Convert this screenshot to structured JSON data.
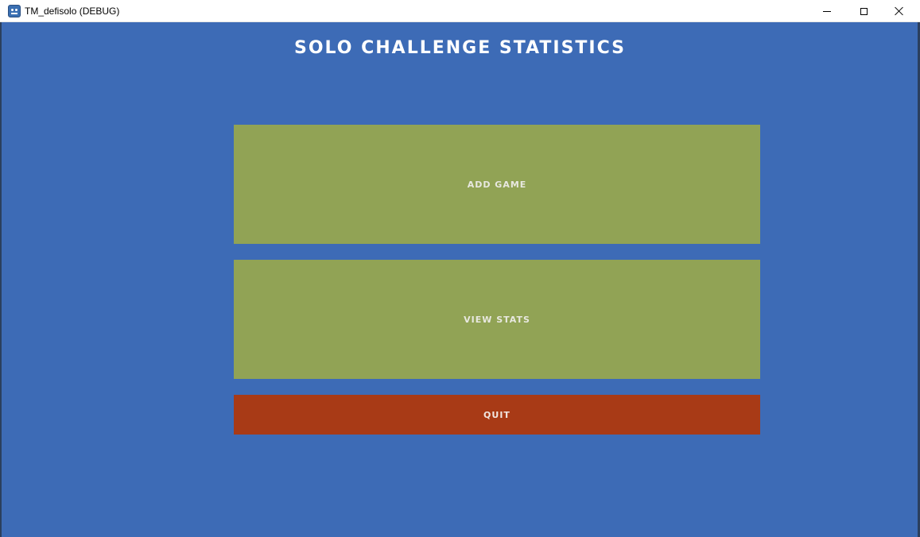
{
  "window": {
    "title": "TM_defisolo (DEBUG)",
    "icon": "godot-engine-icon",
    "controls": {
      "minimize": "minimize-icon",
      "maximize": "maximize-icon",
      "close": "close-icon"
    }
  },
  "page": {
    "heading": "SOLO CHALLENGE STATISTICS",
    "background_color": "#3d6bb6"
  },
  "menu": {
    "add_game_label": "ADD GAME",
    "view_stats_label": "VIEW STATS",
    "quit_label": "QUIT",
    "primary_button_color": "#91a355",
    "quit_button_color": "#a83a16"
  }
}
